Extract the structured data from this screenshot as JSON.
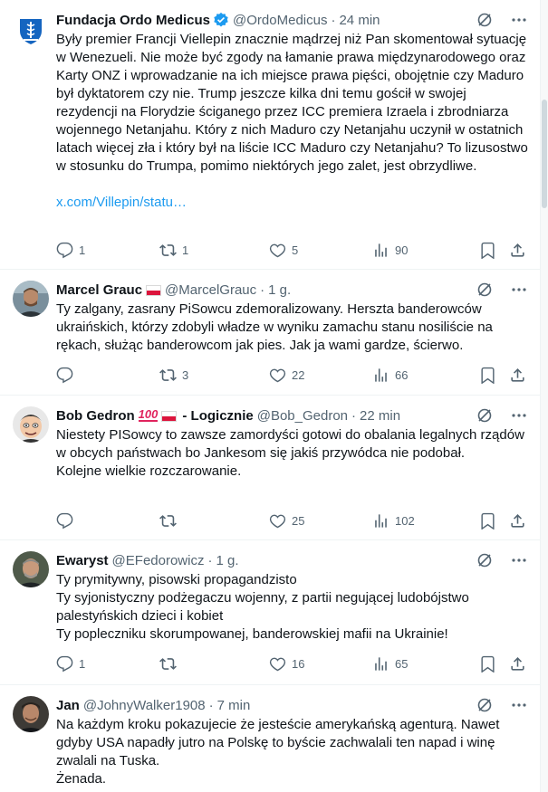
{
  "tweets": [
    {
      "name": "Fundacja Ordo Medicus",
      "handle": "@OrdoMedicus",
      "time": "24 min",
      "text": "Były premier Francji Viellepin znacznie mądrzej niż Pan skomentował sytuację w Wenezueli. Nie może być zgody na łamanie prawa międzynarodowego oraz Karty ONZ i wprowadzanie na ich miejsce prawa pięści, obojętnie czy Maduro był dyktatorem czy nie. Trump jeszcze kilka dni temu gościł w swojej rezydencji na Florydzie ściganego przez ICC premiera Izraela i zbrodniarza wojennego Netanjahu. Który z nich Maduro czy Netanjahu uczynił w ostatnich latach więcej zła i który był na liście ICC Maduro czy Netanjahu? To lizusostwo w stosunku do Trumpa, pomimo niektórych jego zalet, jest obrzydliwe.",
      "link": "x.com/Villepin/statu…",
      "replies": "1",
      "reposts": "1",
      "likes": "5",
      "views": "90"
    },
    {
      "name": "Marcel Grauc",
      "handle": "@MarcelGrauc",
      "time": "1 g.",
      "text": "Ty zalgany, zasrany PiSowcu zdemoralizowany. Herszta banderowców ukraińskich, którzy zdobyli władze w wyniku zamachu stanu nosiliście na rękach, służąc banderowcom jak pies. Jak ja wami gardze, ścierwo.",
      "replies": "",
      "reposts": "3",
      "likes": "22",
      "views": "66"
    },
    {
      "name": "Bob Gedron",
      "name_suffix": "- Logicznie",
      "handle": "@Bob_Gedron",
      "time": "22 min",
      "text": "Niestety PISowcy to zawsze zamordyści gotowi do obalania legalnych rządów w obcych państwach bo Jankesom się jakiś przywódca nie podobał.\nKolejne wielkie rozczarowanie.",
      "replies": "",
      "reposts": "",
      "likes": "25",
      "views": "102"
    },
    {
      "name": "Ewaryst",
      "handle": "@EFedorowicz",
      "time": "1 g.",
      "text": "Ty prymitywny, pisowski propagandzisto\nTy syjonistyczny podżegaczu wojenny, z partii negującej ludobójstwo palestyńskich dzieci i kobiet\nTy popleczniku skorumpowanej, banderowskiej mafii na Ukrainie!",
      "replies": "1",
      "reposts": "",
      "likes": "16",
      "views": "65"
    },
    {
      "name": "Jan",
      "handle": "@JohnyWalker1908",
      "time": "7 min",
      "text": "Na każdym kroku pokazujecie że jesteście amerykańską agenturą. Nawet gdyby USA napadły jutro na Polskę to byście zachwalali ten napad i winę zwalali  na Tuska.\nŻenada."
    }
  ],
  "separator": "·",
  "colors": {
    "text": "#0f1419",
    "secondary": "#536471",
    "link": "#1d9bf0",
    "verified": "#1d9bf0",
    "divider": "#eff3f4"
  },
  "icons": [
    "verified-badge-icon",
    "grok-icon",
    "more-icon",
    "reply-icon",
    "repost-icon",
    "like-icon",
    "views-icon",
    "bookmark-icon",
    "share-icon"
  ]
}
